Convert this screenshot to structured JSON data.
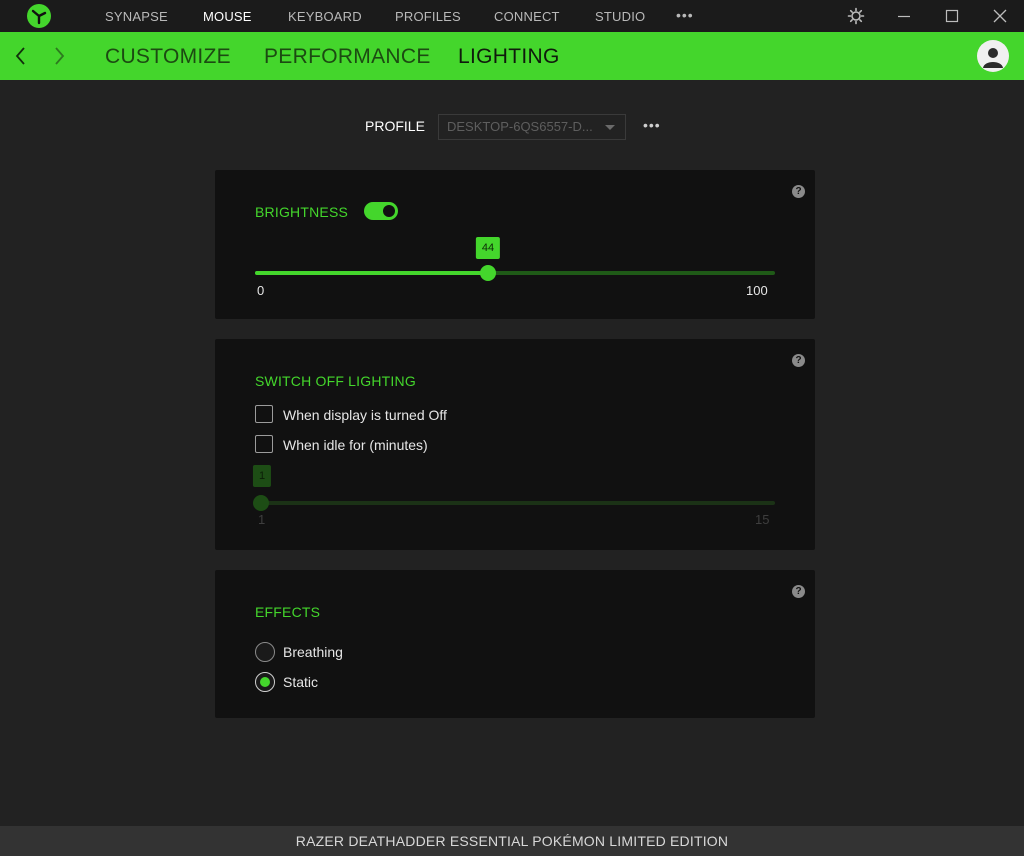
{
  "app": {
    "logo_icon": "razer-logo-icon",
    "accent_color": "#44d62c"
  },
  "topnav": {
    "items": [
      {
        "label": "SYNAPSE"
      },
      {
        "label": "MOUSE"
      },
      {
        "label": "KEYBOARD"
      },
      {
        "label": "PROFILES"
      },
      {
        "label": "CONNECT"
      },
      {
        "label": "STUDIO"
      }
    ],
    "active": "MOUSE",
    "more": "•••"
  },
  "subnav": {
    "items": [
      {
        "label": "CUSTOMIZE"
      },
      {
        "label": "PERFORMANCE"
      },
      {
        "label": "LIGHTING"
      }
    ],
    "active": "LIGHTING"
  },
  "profile": {
    "label": "PROFILE",
    "selected": "DESKTOP-6QS6557-D...",
    "more": "•••"
  },
  "brightness": {
    "title": "BRIGHTNESS",
    "help": "?",
    "enabled": true,
    "value": "44",
    "min": "0",
    "max": "100"
  },
  "switch_off": {
    "title": "SWITCH OFF LIGHTING",
    "help": "?",
    "option_display_off": "When display is turned Off",
    "option_idle": "When idle for (minutes)",
    "display_off_checked": false,
    "idle_checked": false,
    "idle_value": "1",
    "min": "1",
    "max": "15"
  },
  "effects": {
    "title": "EFFECTS",
    "help": "?",
    "options": [
      {
        "label": "Breathing",
        "selected": false
      },
      {
        "label": "Static",
        "selected": true
      }
    ]
  },
  "footer": {
    "device_name": "RAZER DEATHADDER ESSENTIAL POKÉMON LIMITED EDITION"
  }
}
